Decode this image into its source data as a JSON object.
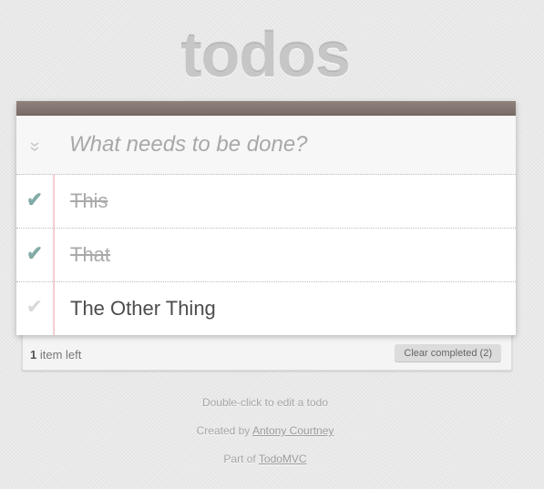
{
  "app": {
    "title": "todos"
  },
  "new_todo": {
    "placeholder": "What needs to be done?",
    "value": ""
  },
  "toggle_all": {
    "icon": "double-chevron-down-icon",
    "glyph": "⌄⌄"
  },
  "todos": [
    {
      "label": "This",
      "completed": true,
      "check_glyph": "✔"
    },
    {
      "label": "That",
      "completed": true,
      "check_glyph": "✔"
    },
    {
      "label": "The Other Thing",
      "completed": false,
      "check_glyph": "✔"
    }
  ],
  "footer": {
    "count": "1",
    "count_suffix": "item left",
    "clear_label": "Clear completed (2)"
  },
  "info": {
    "hint": "Double-click to edit a todo",
    "created_prefix": "Created by",
    "author": "Antony Courtney",
    "part_prefix": "Part of",
    "part_link": "TodoMVC"
  },
  "colors": {
    "header_strip": "#7a6c67",
    "check_completed": "#85ada7",
    "check_inactive": "#d9d9d9",
    "title": "#b3b3b3"
  }
}
